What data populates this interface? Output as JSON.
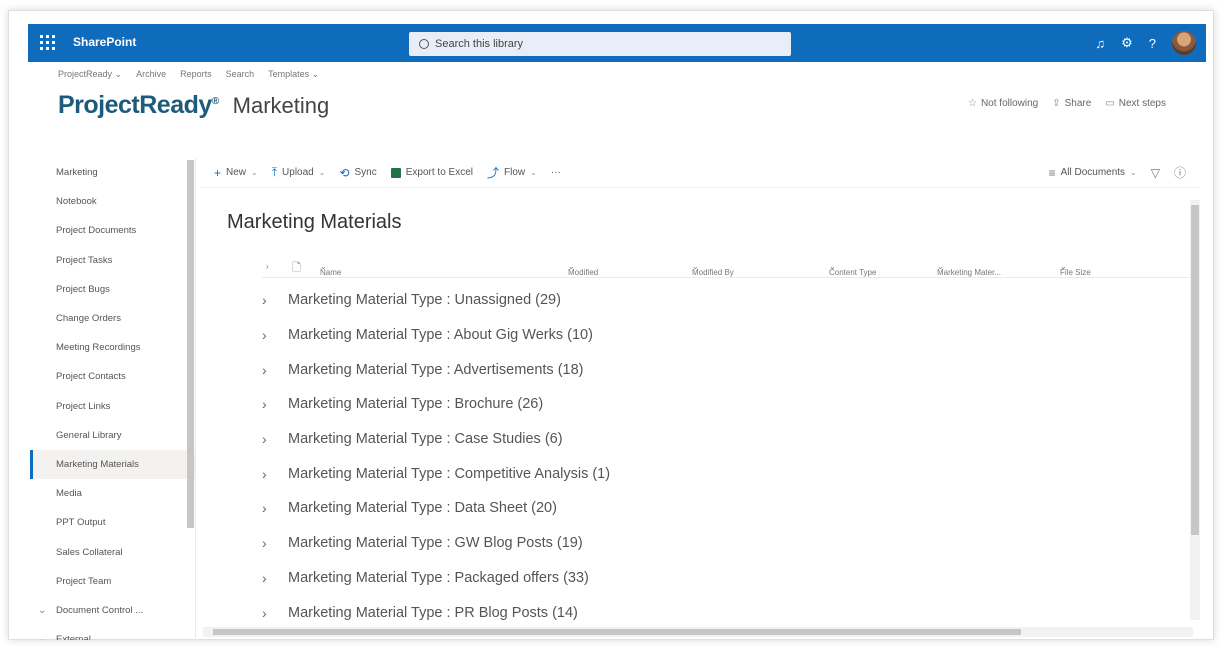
{
  "suitebar": {
    "brand": "SharePoint",
    "search_placeholder": "Search this library",
    "icons": [
      "waffle-icon",
      "bell-icon",
      "gear-icon",
      "help-icon",
      "avatar"
    ],
    "accent": "#0f6cbd"
  },
  "hubnav": [
    "ProjectReady ⌄",
    "Archive",
    "Reports",
    "Search",
    "Templates ⌄"
  ],
  "site": {
    "logo": "ProjectReady",
    "logo_mark": "®",
    "title": "Marketing",
    "actions": [
      {
        "icon": "☆",
        "label": "Not following"
      },
      {
        "icon": "⇪",
        "label": "Share"
      },
      {
        "icon": "▭",
        "label": "Next steps"
      }
    ]
  },
  "leftnav": {
    "items": [
      "Marketing",
      "Notebook",
      "Project Documents",
      "Project Tasks",
      "Project Bugs",
      "Change Orders",
      "Meeting Recordings",
      "Project Contacts",
      "Project Links",
      "General Library",
      "Marketing Materials",
      "Media",
      "PPT Output",
      "Sales Collateral",
      "Project Team",
      "Document Control ...",
      "External"
    ],
    "selected": "Marketing Materials"
  },
  "commandbar": {
    "new": "New",
    "upload": "Upload",
    "sync": "Sync",
    "export": "Export to Excel",
    "flow": "Flow",
    "more": "···",
    "view": "All Documents"
  },
  "library": {
    "title": "Marketing Materials",
    "columns": [
      "Name",
      "Modified",
      "Modified By",
      "Content Type",
      "Marketing Mater...",
      "File Size"
    ],
    "groups": [
      "Marketing Material Type : Unassigned (29)",
      "Marketing Material Type : About Gig Werks (10)",
      "Marketing Material Type : Advertisements (18)",
      "Marketing Material Type : Brochure (26)",
      "Marketing Material Type : Case Studies (6)",
      "Marketing Material Type : Competitive Analysis (1)",
      "Marketing Material Type : Data Sheet (20)",
      "Marketing Material Type : GW Blog Posts (19)",
      "Marketing Material Type : Packaged offers (33)",
      "Marketing Material Type : PR Blog Posts (14)"
    ]
  }
}
